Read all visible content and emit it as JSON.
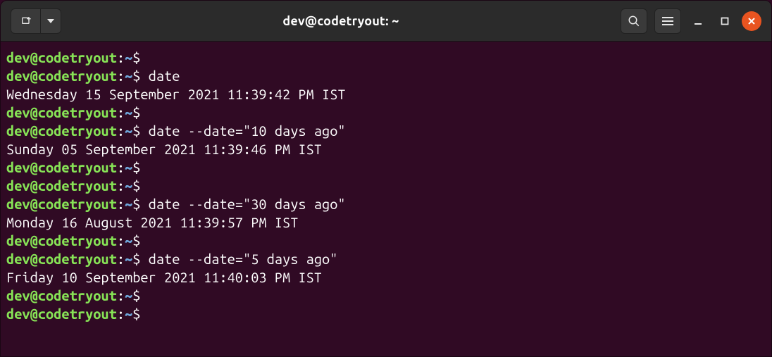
{
  "titlebar": {
    "title": "dev@codetryout: ~"
  },
  "prompt": {
    "userhost": "dev@codetryout",
    "sep": ":",
    "path": "~",
    "symbol": "$"
  },
  "lines": [
    {
      "type": "prompt",
      "cmd": ""
    },
    {
      "type": "prompt",
      "cmd": "date"
    },
    {
      "type": "output",
      "text": "Wednesday 15 September 2021 11:39:42 PM IST"
    },
    {
      "type": "prompt",
      "cmd": ""
    },
    {
      "type": "prompt",
      "cmd": "date --date=\"10 days ago\""
    },
    {
      "type": "output",
      "text": "Sunday 05 September 2021 11:39:46 PM IST"
    },
    {
      "type": "prompt",
      "cmd": ""
    },
    {
      "type": "prompt",
      "cmd": ""
    },
    {
      "type": "prompt",
      "cmd": "date --date=\"30 days ago\""
    },
    {
      "type": "output",
      "text": "Monday 16 August 2021 11:39:57 PM IST"
    },
    {
      "type": "prompt",
      "cmd": ""
    },
    {
      "type": "prompt",
      "cmd": "date --date=\"5 days ago\""
    },
    {
      "type": "output",
      "text": "Friday 10 September 2021 11:40:03 PM IST"
    },
    {
      "type": "prompt",
      "cmd": ""
    },
    {
      "type": "prompt",
      "cmd": ""
    }
  ]
}
